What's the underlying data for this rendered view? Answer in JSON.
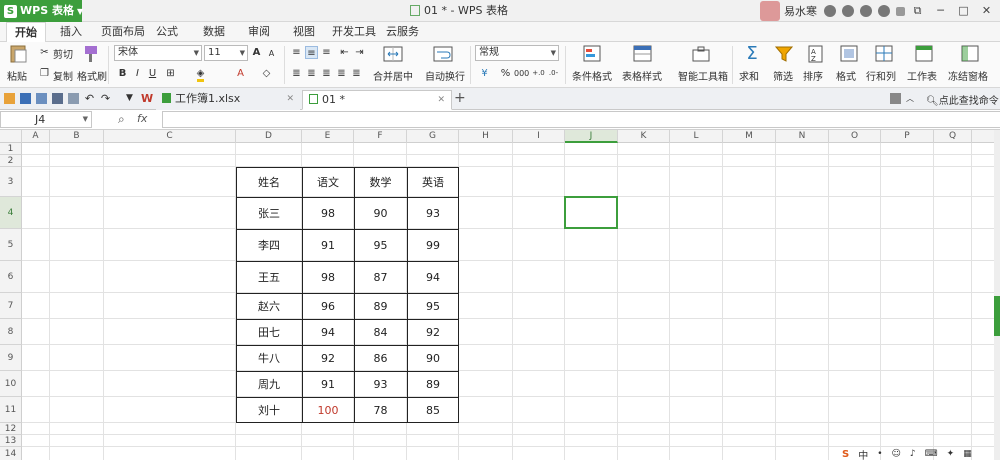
{
  "titlebar": {
    "app_name": "WPS 表格",
    "doc_title": "01 * - WPS 表格",
    "user_name": "易水寒",
    "colors": {
      "accent": "#3c9e3c"
    }
  },
  "menubar": {
    "tabs": [
      "开始",
      "插入",
      "页面布局",
      "公式",
      "数据",
      "审阅",
      "视图",
      "开发工具",
      "云服务"
    ]
  },
  "ribbon": {
    "paste": "粘贴",
    "cut": "剪切",
    "copy": "复制",
    "format_painter": "格式刷",
    "font_name": "宋体",
    "font_size": "11",
    "merge_center": "合并居中",
    "wrap_text": "自动换行",
    "number_format": "常规",
    "percent": "%",
    "conditional_format": "条件格式",
    "table_style": "表格样式",
    "smart_toolbox": "智能工具箱",
    "sum": "求和",
    "filter": "筛选",
    "sort": "排序",
    "format": "格式",
    "rows_cols": "行和列",
    "worksheet": "工作表",
    "freeze": "冻结窗格",
    "find_command": "点此查找命令"
  },
  "workbook_tabs": [
    {
      "label": "工作簿1.xlsx",
      "active": false
    },
    {
      "label": "01 *",
      "active": true
    }
  ],
  "formula_bar": {
    "name_box": "J4",
    "fx": "fx",
    "value": ""
  },
  "grid": {
    "columns": [
      "A",
      "B",
      "C",
      "D",
      "E",
      "F",
      "G",
      "H",
      "I",
      "J",
      "K",
      "L",
      "M",
      "N",
      "O",
      "P",
      "Q"
    ],
    "rows": [
      "1",
      "2",
      "3",
      "4",
      "5",
      "6",
      "7",
      "8",
      "9",
      "10",
      "11",
      "12",
      "13",
      "14"
    ],
    "selected_cell": "J4"
  },
  "score_table": {
    "headers": [
      "姓名",
      "语文",
      "数学",
      "英语"
    ],
    "rows": [
      [
        "张三",
        "98",
        "90",
        "93"
      ],
      [
        "李四",
        "91",
        "95",
        "99"
      ],
      [
        "王五",
        "98",
        "87",
        "94"
      ],
      [
        "赵六",
        "96",
        "89",
        "95"
      ],
      [
        "田七",
        "94",
        "84",
        "92"
      ],
      [
        "牛八",
        "92",
        "86",
        "90"
      ],
      [
        "周九",
        "91",
        "93",
        "89"
      ],
      [
        "刘十",
        "100",
        "78",
        "85"
      ]
    ],
    "highlight_color": "#c0392b"
  }
}
